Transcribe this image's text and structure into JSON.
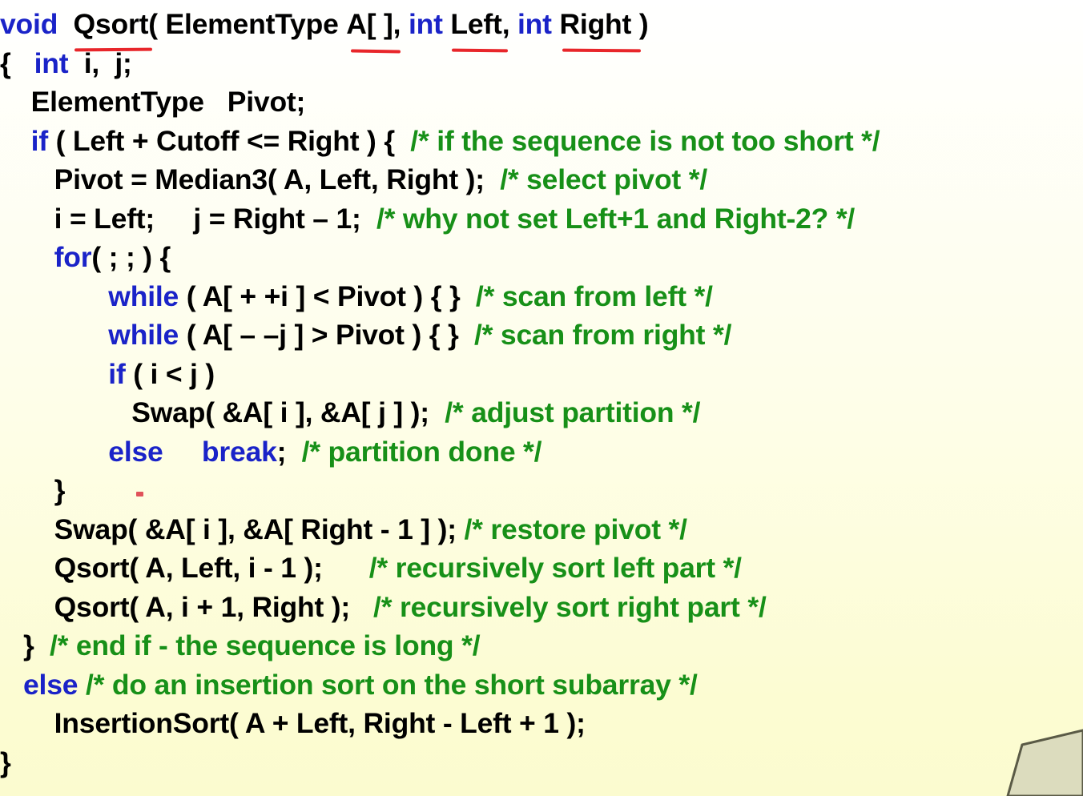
{
  "slide": {
    "title": "Qsort quicksort implementation code listing",
    "background_top_color": "#ffffff",
    "background_bottom_color": "#fbfbcf",
    "keyword_color": "#1a23c8",
    "comment_color": "#179018",
    "identifier_color": "#000000",
    "annotation_color": "#e8262a"
  },
  "annotations": {
    "underlines": [
      "Qsort",
      "A[ ]",
      "Left",
      "Right"
    ],
    "red_dot_mark": "."
  },
  "code": {
    "lines": [
      {
        "indent": 0,
        "tokens": [
          {
            "kind": "kw",
            "text": "void"
          },
          {
            "kind": "id",
            "text": "  "
          },
          {
            "kind": "id",
            "text": "Qsort",
            "underline": 1
          },
          {
            "kind": "id",
            "text": "( ElementType "
          },
          {
            "kind": "id",
            "text": "A[ ]",
            "underline": 2
          },
          {
            "kind": "id",
            "text": ", "
          },
          {
            "kind": "kw",
            "text": "int"
          },
          {
            "kind": "id",
            "text": " "
          },
          {
            "kind": "id",
            "text": "Left",
            "underline": 3
          },
          {
            "kind": "id",
            "text": ", "
          },
          {
            "kind": "kw",
            "text": "int"
          },
          {
            "kind": "id",
            "text": " "
          },
          {
            "kind": "id",
            "text": "Right",
            "underline": 4
          },
          {
            "kind": "id",
            "text": " )"
          }
        ]
      },
      {
        "indent": 0,
        "tokens": [
          {
            "kind": "id",
            "text": "{   "
          },
          {
            "kind": "kw",
            "text": "int"
          },
          {
            "kind": "id",
            "text": "  i,  j;"
          }
        ]
      },
      {
        "indent": 0,
        "tokens": [
          {
            "kind": "id",
            "text": "    ElementType   Pivot;"
          }
        ]
      },
      {
        "indent": 0,
        "tokens": [
          {
            "kind": "id",
            "text": "    "
          },
          {
            "kind": "kw",
            "text": "if"
          },
          {
            "kind": "id",
            "text": " ( Left + Cutoff <= Right ) {  "
          },
          {
            "kind": "cm",
            "text": "/* if the sequence is not too short */"
          }
        ]
      },
      {
        "indent": 0,
        "tokens": [
          {
            "kind": "id",
            "text": "       Pivot = Median3( A, Left, Right );  "
          },
          {
            "kind": "cm",
            "text": "/* select pivot */"
          }
        ]
      },
      {
        "indent": 0,
        "tokens": [
          {
            "kind": "id",
            "text": "       i = Left;     j = Right – 1;  "
          },
          {
            "kind": "cm",
            "text": "/* why not set Left+1 and Right-2? */"
          }
        ]
      },
      {
        "indent": 0,
        "tokens": [
          {
            "kind": "id",
            "text": "       "
          },
          {
            "kind": "kw",
            "text": "for"
          },
          {
            "kind": "id",
            "text": "( ; ; ) {"
          }
        ]
      },
      {
        "indent": 0,
        "tokens": [
          {
            "kind": "id",
            "text": "              "
          },
          {
            "kind": "kw",
            "text": "while"
          },
          {
            "kind": "id",
            "text": " ( A[ + +i ] < Pivot ) { }  "
          },
          {
            "kind": "cm",
            "text": "/* scan from left */"
          }
        ]
      },
      {
        "indent": 0,
        "tokens": [
          {
            "kind": "id",
            "text": "              "
          },
          {
            "kind": "kw",
            "text": "while"
          },
          {
            "kind": "id",
            "text": " ( A[ – –j ] > Pivot ) { }  "
          },
          {
            "kind": "cm",
            "text": "/* scan from right */"
          }
        ]
      },
      {
        "indent": 0,
        "tokens": [
          {
            "kind": "id",
            "text": "              "
          },
          {
            "kind": "kw",
            "text": "if"
          },
          {
            "kind": "id",
            "text": " ( i < j )"
          }
        ]
      },
      {
        "indent": 0,
        "tokens": [
          {
            "kind": "id",
            "text": "                 Swap( &A[ i ], &A[ j ] );  "
          },
          {
            "kind": "cm",
            "text": "/* adjust partition */"
          }
        ]
      },
      {
        "indent": 0,
        "tokens": [
          {
            "kind": "id",
            "text": "              "
          },
          {
            "kind": "kw",
            "text": "else"
          },
          {
            "kind": "id",
            "text": "     "
          },
          {
            "kind": "kw",
            "text": "break"
          },
          {
            "kind": "id",
            "text": ";  "
          },
          {
            "kind": "cm",
            "text": "/* partition done */"
          }
        ]
      },
      {
        "indent": 0,
        "tokens": [
          {
            "kind": "id",
            "text": "       }"
          }
        ]
      },
      {
        "indent": 0,
        "tokens": [
          {
            "kind": "id",
            "text": "       Swap( &A[ i ], &A[ Right - 1 ] ); "
          },
          {
            "kind": "cm",
            "text": "/* restore pivot */"
          }
        ]
      },
      {
        "indent": 0,
        "tokens": [
          {
            "kind": "id",
            "text": "       Qsort( A, Left, i - 1 );      "
          },
          {
            "kind": "cm",
            "text": "/* recursively sort left part */"
          }
        ]
      },
      {
        "indent": 0,
        "tokens": [
          {
            "kind": "id",
            "text": "       Qsort( A, i + 1, Right );   "
          },
          {
            "kind": "cm",
            "text": "/* recursively sort right part */"
          }
        ]
      },
      {
        "indent": 0,
        "tokens": [
          {
            "kind": "id",
            "text": "   }  "
          },
          {
            "kind": "cm",
            "text": "/* end if - the sequence is long */"
          }
        ]
      },
      {
        "indent": 0,
        "tokens": [
          {
            "kind": "id",
            "text": "   "
          },
          {
            "kind": "kw",
            "text": "else"
          },
          {
            "kind": "id",
            "text": " "
          },
          {
            "kind": "cm",
            "text": "/* do an insertion sort on the short subarray */"
          }
        ]
      },
      {
        "indent": 0,
        "tokens": [
          {
            "kind": "id",
            "text": "       InsertionSort( A + Left, Right - Left + 1 );"
          }
        ]
      },
      {
        "indent": 0,
        "tokens": [
          {
            "kind": "id",
            "text": "}"
          }
        ]
      }
    ]
  }
}
